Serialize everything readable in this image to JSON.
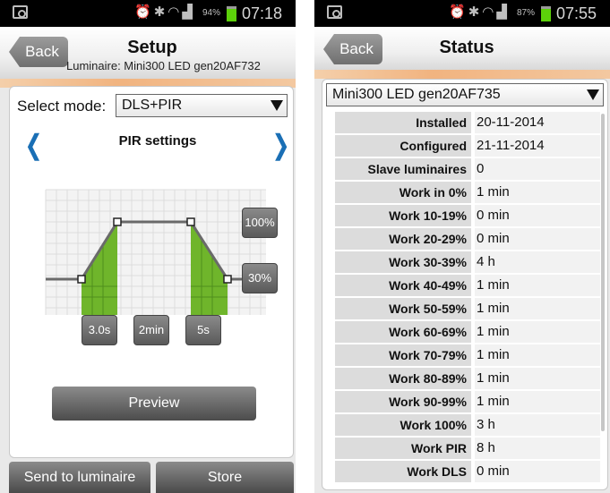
{
  "setup": {
    "status": {
      "battery": "94%",
      "time": "07:18"
    },
    "back_label": "Back",
    "title": "Setup",
    "subtitle": "Luminaire: Mini300 LED gen20AF732",
    "mode_label": "Select mode:",
    "mode_value": "DLS+PIR",
    "section_title": "PIR settings",
    "nav_prev": "❬",
    "nav_next": "❭",
    "levels": {
      "high": "100%",
      "low": "30%"
    },
    "times": {
      "fade_in": "3.0s",
      "hold": "2min",
      "fade_out": "5s"
    },
    "preview_label": "Preview",
    "send_label": "Send to luminaire",
    "store_label": "Store"
  },
  "status_screen": {
    "status": {
      "battery": "87%",
      "time": "07:55"
    },
    "back_label": "Back",
    "title": "Status",
    "luminaire": "Mini300 LED gen20AF735",
    "rows": [
      {
        "key": "Installed",
        "value": "20-11-2014"
      },
      {
        "key": "Configured",
        "value": "21-11-2014"
      },
      {
        "key": "Slave luminaires",
        "value": "0"
      },
      {
        "key": "Work in 0%",
        "value": "1 min"
      },
      {
        "key": "Work 10-19%",
        "value": "0 min"
      },
      {
        "key": "Work 20-29%",
        "value": "0 min"
      },
      {
        "key": "Work 30-39%",
        "value": "4 h"
      },
      {
        "key": "Work 40-49%",
        "value": "1 min"
      },
      {
        "key": "Work 50-59%",
        "value": "1 min"
      },
      {
        "key": "Work 60-69%",
        "value": "1 min"
      },
      {
        "key": "Work 70-79%",
        "value": "1 min"
      },
      {
        "key": "Work 80-89%",
        "value": "1 min"
      },
      {
        "key": "Work 90-99%",
        "value": "1 min"
      },
      {
        "key": "Work 100%",
        "value": "3 h"
      },
      {
        "key": "Work PIR",
        "value": "8 h"
      },
      {
        "key": "Work DLS",
        "value": "0 min"
      }
    ]
  },
  "colors": {
    "accent_green": "#6fb52b",
    "link_blue": "#1a6fb5",
    "battery_green": "#5cd10a"
  },
  "icons": {
    "status_left": "image-icon",
    "status_right": [
      "alarm-icon",
      "bluetooth-icon",
      "wifi-icon",
      "signal-icon",
      "battery-icon"
    ],
    "dropdown": "triangle-down-icon"
  }
}
